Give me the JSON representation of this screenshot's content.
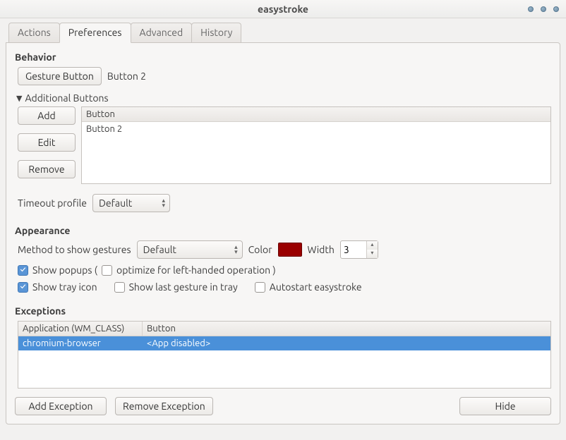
{
  "window": {
    "title": "easystroke"
  },
  "tabs": {
    "items": [
      {
        "label": "Actions"
      },
      {
        "label": "Preferences"
      },
      {
        "label": "Advanced"
      },
      {
        "label": "History"
      }
    ],
    "active": 1
  },
  "behavior": {
    "heading": "Behavior",
    "gesture_button_label": "Gesture Button",
    "gesture_button_value": "Button 2",
    "additional_heading": "Additional Buttons",
    "add_label": "Add",
    "edit_label": "Edit",
    "remove_label": "Remove",
    "col_button": "Button",
    "rows": [
      {
        "button": "Button 2"
      }
    ],
    "timeout_label": "Timeout profile",
    "timeout_value": "Default"
  },
  "appearance": {
    "heading": "Appearance",
    "method_label": "Method to show gestures",
    "method_value": "Default",
    "color_label": "Color",
    "color_value": "#9a0000",
    "width_label": "Width",
    "width_value": "3",
    "show_popups_label": "Show popups (",
    "left_handed_label": "optimize for left-handed operation )",
    "show_tray_label": "Show tray icon",
    "show_last_gesture_label": "Show last gesture in tray",
    "autostart_label": "Autostart easystroke",
    "show_popups_checked": true,
    "left_handed_checked": false,
    "show_tray_checked": true,
    "show_last_gesture_checked": false,
    "autostart_checked": false
  },
  "exceptions": {
    "heading": "Exceptions",
    "col_app": "Application (WM_CLASS)",
    "col_button": "Button",
    "rows": [
      {
        "app": "chromium-browser",
        "button": "<App disabled>",
        "selected": true
      }
    ],
    "add_label": "Add Exception",
    "remove_label": "Remove Exception",
    "hide_label": "Hide"
  }
}
